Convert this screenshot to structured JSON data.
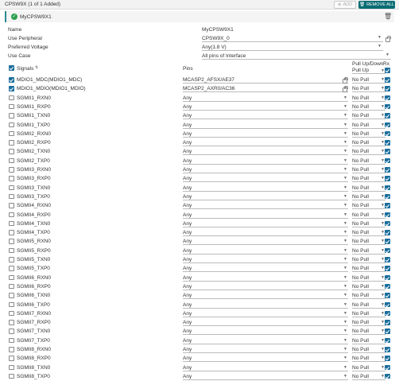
{
  "header": {
    "title": "CPSW9X (1 of 1 Added)",
    "add_label": "ADD",
    "remove_all_label": "REMOVE ALL"
  },
  "instance": {
    "name": "MyCPSW9X1"
  },
  "props": [
    {
      "label": "Name",
      "value": "MyCPSW9X1"
    },
    {
      "label": "Use Peripheral",
      "value": "CPSW9X_0"
    },
    {
      "label": "Preferred Voltage",
      "value": "Any(1.8 V)"
    },
    {
      "label": "Use Case",
      "value": "All pins of Interface"
    }
  ],
  "table": {
    "col_signals": "Signals",
    "col_pins": "Pins",
    "col_pull": "Pull Up/Down",
    "col_rx": "Rx",
    "pull_header_value": "Pull Up",
    "rows": [
      {
        "signal": "MDIO1_MDC(MDIO1_MDC)",
        "pin": "MCASP2_AFSX/AE37",
        "pull": "No Pull",
        "checked": true,
        "locked": true
      },
      {
        "signal": "MDIO1_MDIO(MDIO1_MDIO)",
        "pin": "MCASP2_AXR0/AC36",
        "pull": "No Pull",
        "checked": true,
        "locked": true
      },
      {
        "signal": "SGMII1_RXN0",
        "pin": "Any",
        "pull": "No Pull",
        "checked": false
      },
      {
        "signal": "SGMII1_RXP0",
        "pin": "Any",
        "pull": "No Pull",
        "checked": false
      },
      {
        "signal": "SGMII1_TXN0",
        "pin": "Any",
        "pull": "No Pull",
        "checked": false
      },
      {
        "signal": "SGMII1_TXP0",
        "pin": "Any",
        "pull": "No Pull",
        "checked": false
      },
      {
        "signal": "SGMII2_RXN0",
        "pin": "Any",
        "pull": "No Pull",
        "checked": false
      },
      {
        "signal": "SGMII2_RXP0",
        "pin": "Any",
        "pull": "No Pull",
        "checked": false
      },
      {
        "signal": "SGMII2_TXN0",
        "pin": "Any",
        "pull": "No Pull",
        "checked": false
      },
      {
        "signal": "SGMII2_TXP0",
        "pin": "Any",
        "pull": "No Pull",
        "checked": false
      },
      {
        "signal": "SGMII3_RXN0",
        "pin": "Any",
        "pull": "No Pull",
        "checked": false
      },
      {
        "signal": "SGMII3_RXP0",
        "pin": "Any",
        "pull": "No Pull",
        "checked": false
      },
      {
        "signal": "SGMII3_TXN0",
        "pin": "Any",
        "pull": "No Pull",
        "checked": false
      },
      {
        "signal": "SGMII3_TXP0",
        "pin": "Any",
        "pull": "No Pull",
        "checked": false
      },
      {
        "signal": "SGMII4_RXN0",
        "pin": "Any",
        "pull": "No Pull",
        "checked": false
      },
      {
        "signal": "SGMII4_RXP0",
        "pin": "Any",
        "pull": "No Pull",
        "checked": false
      },
      {
        "signal": "SGMII4_TXN0",
        "pin": "Any",
        "pull": "No Pull",
        "checked": false
      },
      {
        "signal": "SGMII4_TXP0",
        "pin": "Any",
        "pull": "No Pull",
        "checked": false
      },
      {
        "signal": "SGMII5_RXN0",
        "pin": "Any",
        "pull": "No Pull",
        "checked": false
      },
      {
        "signal": "SGMII5_RXP0",
        "pin": "Any",
        "pull": "No Pull",
        "checked": false
      },
      {
        "signal": "SGMII5_TXN0",
        "pin": "Any",
        "pull": "No Pull",
        "checked": false
      },
      {
        "signal": "SGMII5_TXP0",
        "pin": "Any",
        "pull": "No Pull",
        "checked": false
      },
      {
        "signal": "SGMII6_RXN0",
        "pin": "Any",
        "pull": "No Pull",
        "checked": false
      },
      {
        "signal": "SGMII6_RXP0",
        "pin": "Any",
        "pull": "No Pull",
        "checked": false
      },
      {
        "signal": "SGMII6_TXN0",
        "pin": "Any",
        "pull": "No Pull",
        "checked": false
      },
      {
        "signal": "SGMII6_TXP0",
        "pin": "Any",
        "pull": "No Pull",
        "checked": false
      },
      {
        "signal": "SGMII7_RXN0",
        "pin": "Any",
        "pull": "No Pull",
        "checked": false
      },
      {
        "signal": "SGMII7_RXP0",
        "pin": "Any",
        "pull": "No Pull",
        "checked": false
      },
      {
        "signal": "SGMII7_TXN0",
        "pin": "Any",
        "pull": "No Pull",
        "checked": false
      },
      {
        "signal": "SGMII7_TXP0",
        "pin": "Any",
        "pull": "No Pull",
        "checked": false
      },
      {
        "signal": "SGMII8_RXN0",
        "pin": "Any",
        "pull": "No Pull",
        "checked": false
      },
      {
        "signal": "SGMII8_RXP0",
        "pin": "Any",
        "pull": "No Pull",
        "checked": false
      },
      {
        "signal": "SGMII8_TXN0",
        "pin": "Any",
        "pull": "No Pull",
        "checked": false
      },
      {
        "signal": "SGMII8_TXP0",
        "pin": "Any",
        "pull": "No Pull",
        "checked": false
      }
    ]
  },
  "colors": {
    "accent": "#0a6d74",
    "checkbox": "#1b6e9c",
    "ok": "#2e9e4f"
  }
}
